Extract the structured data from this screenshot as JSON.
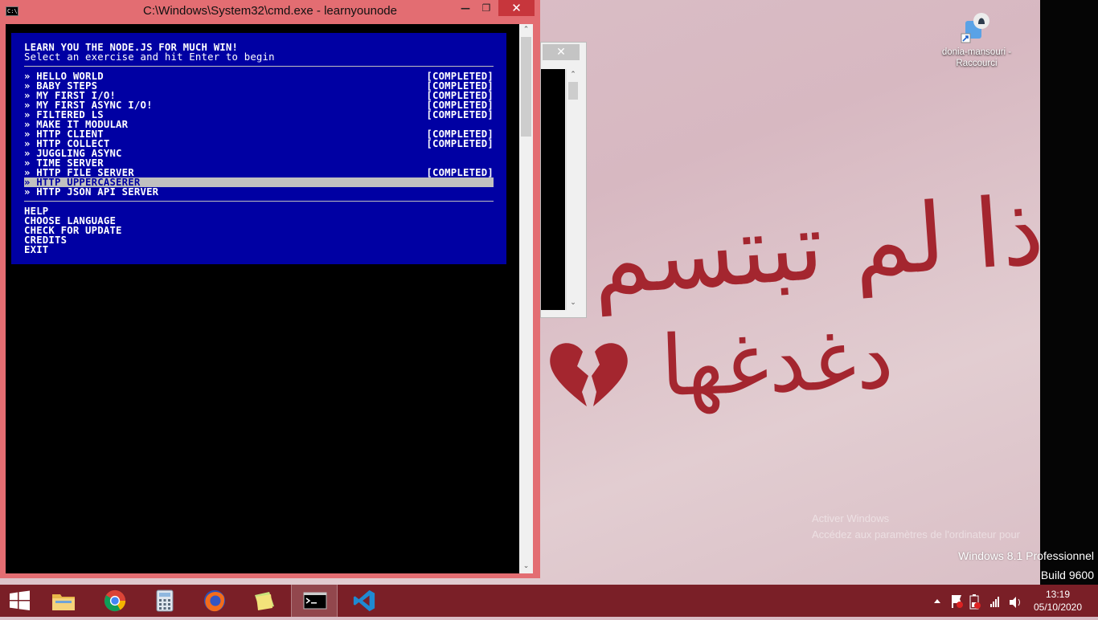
{
  "cmd_window": {
    "title": "C:\\Windows\\System32\\cmd.exe - learnyounode",
    "icon_text": "C:\\",
    "min_glyph": "—",
    "max_glyph": "❐",
    "close_glyph": "✕"
  },
  "learnyounode": {
    "heading": "LEARN YOU THE NODE.JS FOR MUCH WIN!",
    "subheading": "Select an exercise and hit Enter to begin",
    "exercises": [
      {
        "label": "» HELLO WORLD",
        "status": "[COMPLETED]"
      },
      {
        "label": "» BABY STEPS",
        "status": "[COMPLETED]"
      },
      {
        "label": "» MY FIRST I/O!",
        "status": "[COMPLETED]"
      },
      {
        "label": "» MY FIRST ASYNC I/O!",
        "status": "[COMPLETED]"
      },
      {
        "label": "» FILTERED LS",
        "status": "[COMPLETED]"
      },
      {
        "label": "» MAKE IT MODULAR",
        "status": ""
      },
      {
        "label": "» HTTP CLIENT",
        "status": "[COMPLETED]"
      },
      {
        "label": "» HTTP COLLECT",
        "status": "[COMPLETED]"
      },
      {
        "label": "» JUGGLING ASYNC",
        "status": ""
      },
      {
        "label": "» TIME SERVER",
        "status": ""
      },
      {
        "label": "» HTTP FILE SERVER",
        "status": "[COMPLETED]"
      },
      {
        "label": "» HTTP UPPERCASERER",
        "status": "",
        "selected": true
      },
      {
        "label": "» HTTP JSON API SERVER",
        "status": ""
      }
    ],
    "options": [
      "HELP",
      "CHOOSE LANGUAGE",
      "CHECK FOR UPDATE",
      "CREDITS",
      "EXIT"
    ]
  },
  "background_window": {
    "close_glyph": "✕",
    "scroll_up": "⌃",
    "scroll_down": "⌄"
  },
  "desktop": {
    "shortcut_label": "donia-mansouri - Raccourci",
    "watermark_activate_1": "Activer Windows",
    "watermark_activate_2": "Accédez aux paramètres de l'ordinateur pour",
    "os_name": "Windows 8.1 Professionnel",
    "build": "Build 9600",
    "wallpaper_line1": "إذا لم تبتسم",
    "wallpaper_line2": "دغدغها"
  },
  "taskbar": {
    "apps": [
      {
        "name": "file-explorer",
        "icon": "folder-icon"
      },
      {
        "name": "chrome",
        "icon": "chrome-icon"
      },
      {
        "name": "calculator",
        "icon": "calculator-icon"
      },
      {
        "name": "firefox",
        "icon": "firefox-icon"
      },
      {
        "name": "sticky-notes",
        "icon": "sticky-notes-icon"
      },
      {
        "name": "command-prompt",
        "icon": "cmd-icon"
      },
      {
        "name": "visual-studio-code",
        "icon": "vscode-icon"
      }
    ],
    "time": "13:19",
    "date": "05/10/2020"
  },
  "colors": {
    "cmd_frame": "#e36d72",
    "menu_bg": "#0000a3",
    "taskbar": "#7a1f27",
    "wall_ink": "#a4262f"
  }
}
